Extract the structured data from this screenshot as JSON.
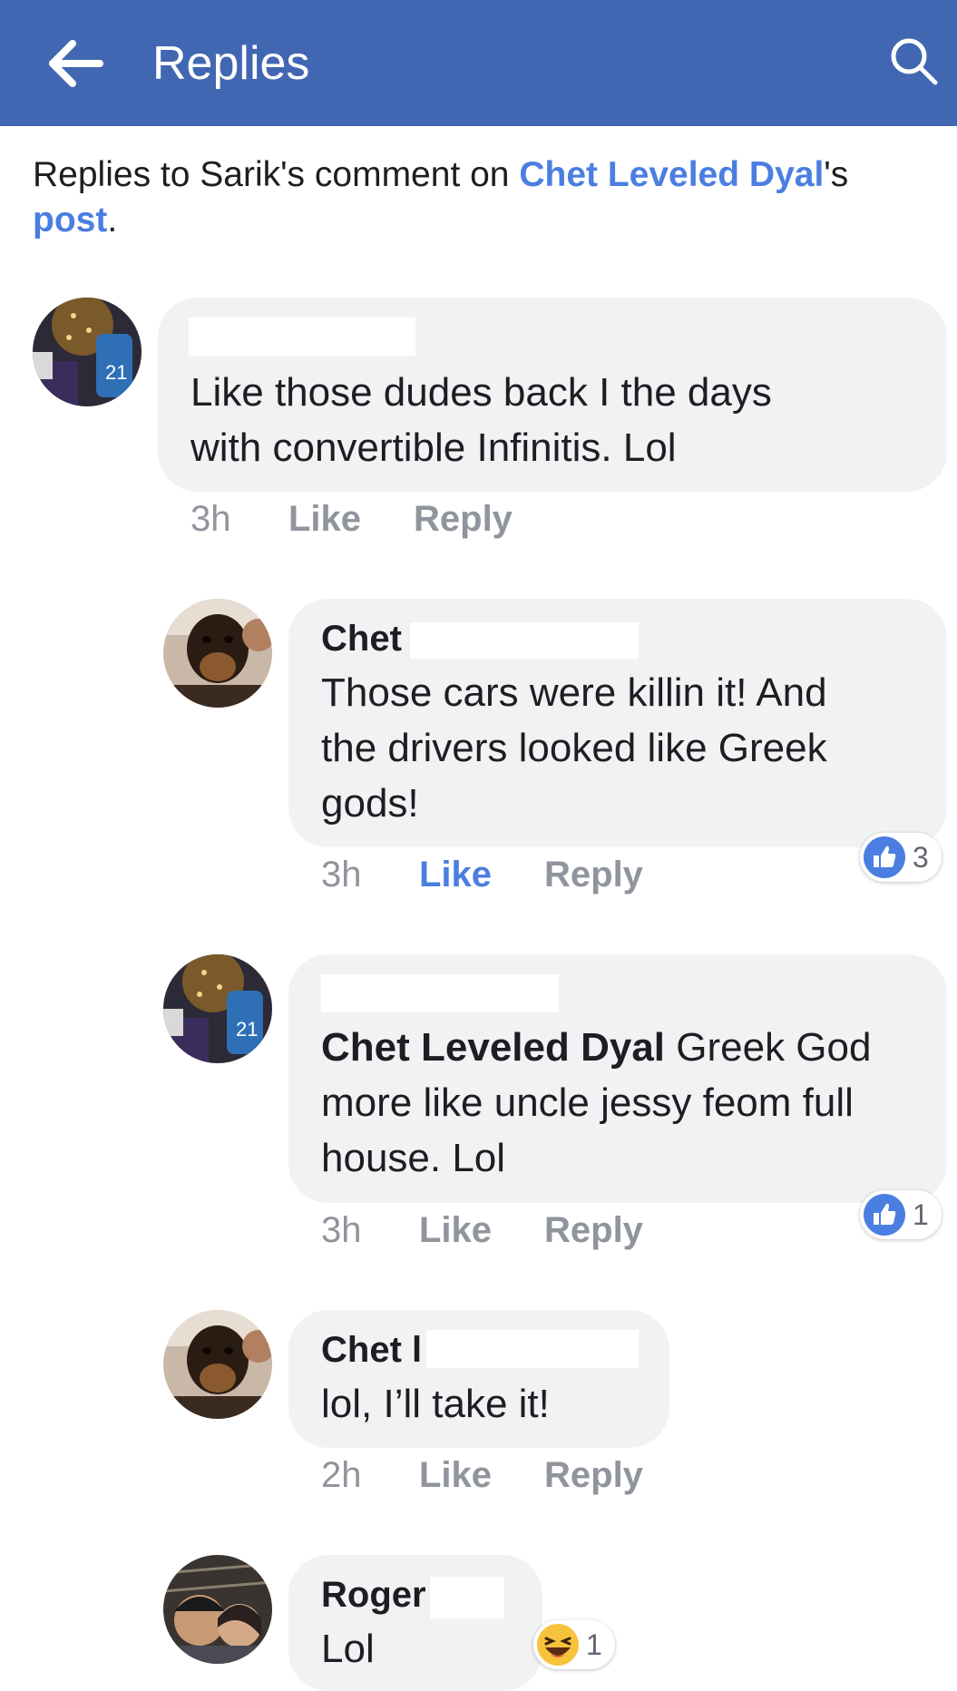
{
  "header": {
    "title": "Replies",
    "back_icon": "back-arrow-icon",
    "search_icon": "search-icon",
    "color": "#4267b2"
  },
  "context": {
    "prefix": "Replies to Sarik's comment on ",
    "owner": "Chet Leveled Dyal",
    "possessive": "'s",
    "post_link": "post",
    "suffix": "."
  },
  "comments": [
    {
      "author": "",
      "text_line1": "Like those dudes back I  the days",
      "text_line2": "with convertible Infinitis.  Lol",
      "time": "3h",
      "like": "Like",
      "reply": "Reply"
    },
    {
      "author": "Chet",
      "text_line1": "Those cars were killin it!  And",
      "text_line2": "the drivers looked like Greek",
      "text_line3": "gods!",
      "time": "3h",
      "like": "Like",
      "reply": "Reply",
      "reaction_icon": "thumbs-up-icon",
      "reaction_count": "3"
    },
    {
      "author": "",
      "mention": "Chet Leveled Dyal",
      "text_line1": " Greek God",
      "text_line2": "more like uncle jessy feom full",
      "text_line3": "house.  Lol",
      "time": "3h",
      "like": "Like",
      "reply": "Reply",
      "reaction_icon": "thumbs-up-icon",
      "reaction_count": "1"
    },
    {
      "author": "Chet l",
      "text_line1": "lol, I’ll take it!",
      "time": "2h",
      "like": "Like",
      "reply": "Reply"
    },
    {
      "author": "Roger",
      "text_line1": "Lol",
      "reaction_icon": "laughing-emoji-icon",
      "reaction_count": "1"
    }
  ]
}
